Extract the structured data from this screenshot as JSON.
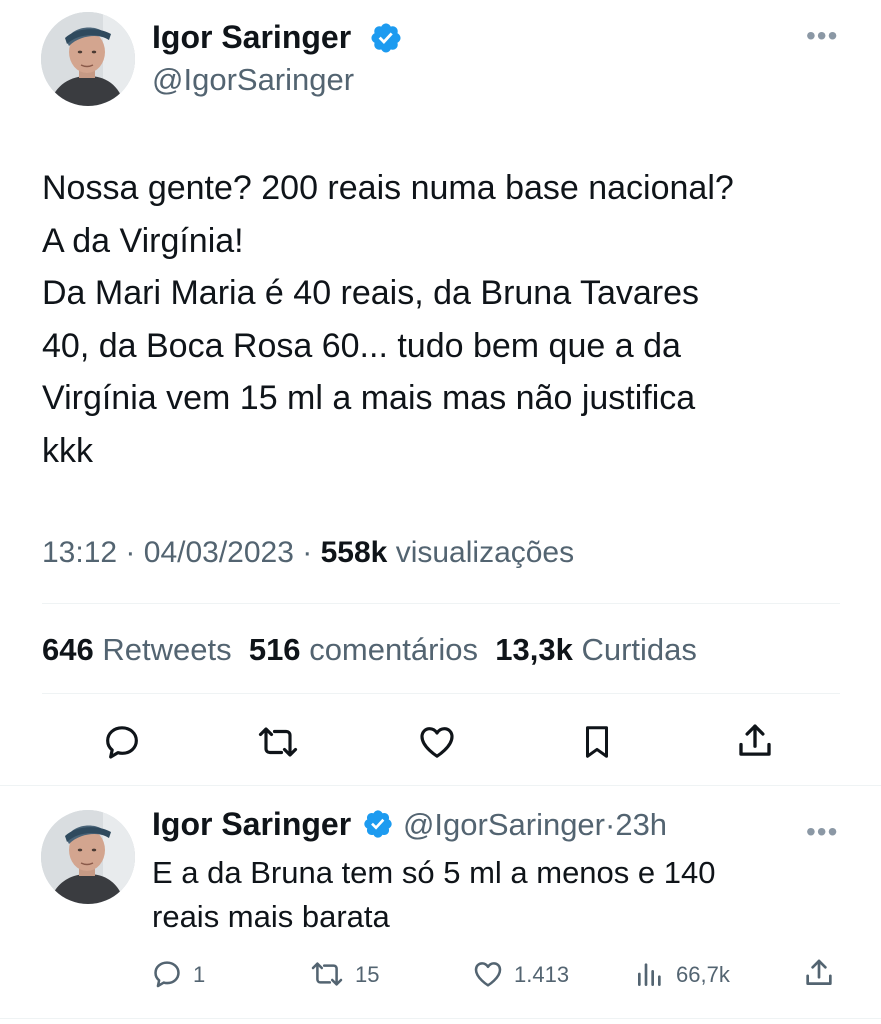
{
  "tweet": {
    "author": {
      "name": "Igor Saringer",
      "handle": "@IgorSaringer"
    },
    "text_lines": [
      "Nossa gente? 200 reais numa base nacional?",
      "A da Virgínia!",
      "Da Mari Maria é 40 reais, da Bruna Tavares",
      "40, da Boca Rosa 60... tudo bem que a da",
      "Virgínia vem 15 ml a mais mas não justifica",
      "kkk"
    ],
    "time": "13:12",
    "date": "04/03/2023",
    "separator": "·",
    "views_count": "558k",
    "views_label": "visualizações",
    "stats": {
      "retweets_count": "646",
      "retweets_label": "Retweets",
      "comments_count": "516",
      "comments_label": "comentários",
      "likes_count": "13,3k",
      "likes_label": "Curtidas"
    }
  },
  "reply": {
    "author": {
      "name": "Igor Saringer",
      "handle": "@IgorSaringer"
    },
    "time_ago": "23h",
    "separator": "·",
    "text_lines": [
      "E a da Bruna tem só 5 ml a menos e 140",
      "reais mais barata"
    ],
    "actions": {
      "replies": "1",
      "retweets": "15",
      "likes": "1.413",
      "views": "66,7k"
    }
  },
  "icons": {
    "more": "more-icon",
    "verified": "verified-badge-icon",
    "reply": "reply-icon",
    "retweet": "retweet-icon",
    "like": "heart-icon",
    "bookmark": "bookmark-icon",
    "share": "share-icon",
    "views": "views-icon"
  },
  "colors": {
    "text": "#0f1419",
    "secondary": "#536471",
    "verified": "#1d9bf0",
    "divider": "#eff3f4"
  }
}
